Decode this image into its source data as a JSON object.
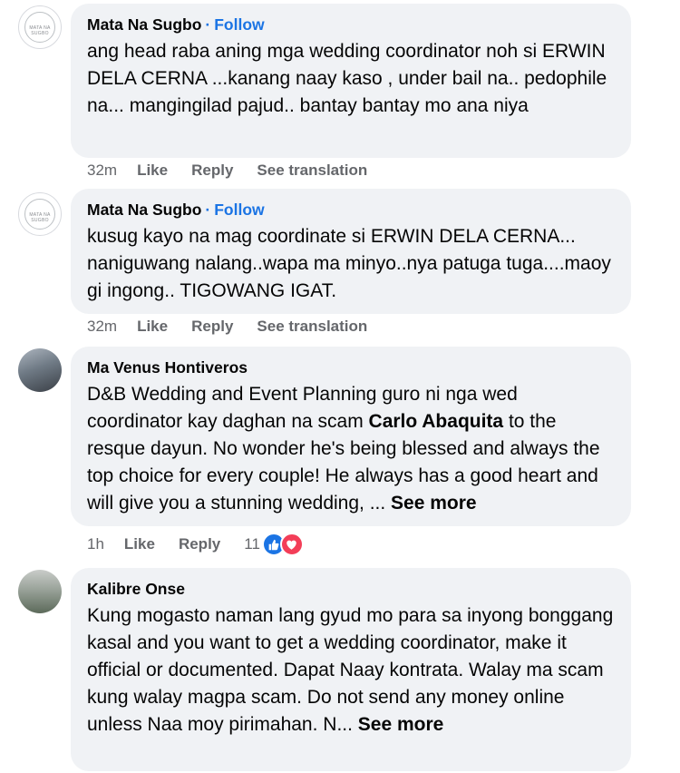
{
  "comments": [
    {
      "author": "Mata Na Sugbo",
      "follow": "Follow",
      "avatar_text": "MATA NA SUGBO",
      "text": "ang head raba aning mga wedding coordinator noh si ERWIN DELA CERNA ...kanang naay kaso , under bail na.. pedophile na... mangingilad pajud.. bantay bantay mo ana niya",
      "time": "32m",
      "like": "Like",
      "reply": "Reply",
      "translate": "See translation"
    },
    {
      "author": "Mata Na Sugbo",
      "follow": "Follow",
      "avatar_text": "MATA NA SUGBO",
      "text": "kusug kayo na mag coordinate si ERWIN DELA CERNA... naniguwang nalang..wapa ma minyo..nya patuga tuga....maoy gi ingong.. TIGOWANG IGAT.",
      "time": "32m",
      "like": "Like",
      "reply": "Reply",
      "translate": "See translation"
    },
    {
      "author": "Ma Venus Hontiveros",
      "text_before": "D&B Wedding and Event Planning guro ni nga wed coordinator kay daghan na scam ",
      "mention": "Carlo Abaquita",
      "text_after": " to the resque dayun. No wonder he's being blessed and always the top choice for every couple! He always has a good heart and will give you a stunning wedding, ... ",
      "see_more": "See more",
      "time": "1h",
      "like": "Like",
      "reply": "Reply",
      "reaction_count": "11"
    },
    {
      "author": "Kalibre Onse",
      "text": "Kung mogasto naman lang gyud mo para sa inyong bonggang kasal and you want to get a wedding coordinator, make it official or documented. Dapat Naay kontrata. Walay ma scam kung walay magpa scam. Do not send any money online unless Naa moy pirimahan. N... ",
      "see_more": "See more"
    }
  ],
  "colors": {
    "link": "#1b74e4",
    "bubble": "#f0f2f5",
    "meta": "#65676b",
    "like": "#1b74e4",
    "love": "#f33e58"
  },
  "icons": {
    "like": "thumbs-up-icon",
    "love": "heart-icon"
  }
}
